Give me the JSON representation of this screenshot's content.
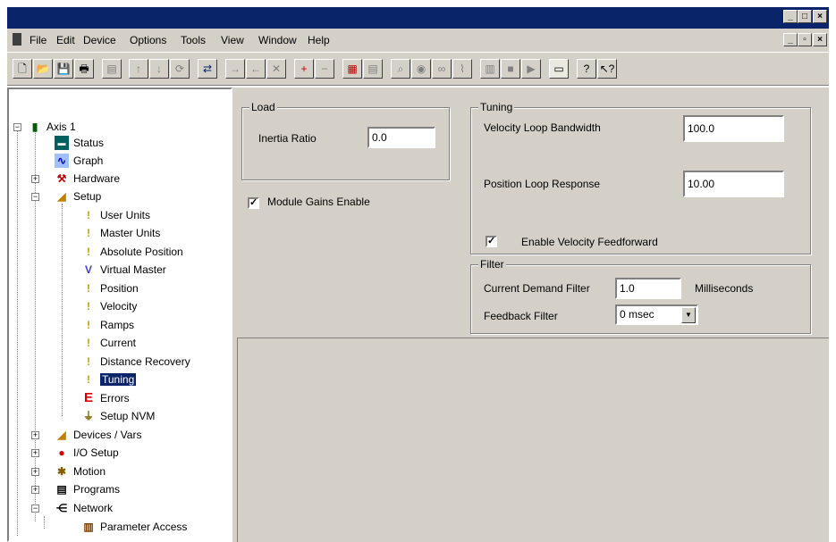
{
  "titlebar": {
    "title": ""
  },
  "menu": [
    "File",
    "Edit",
    "Device",
    "Options",
    "Tools",
    "View",
    "Window",
    "Help"
  ],
  "toolbar": {
    "icons": [
      "new-icon",
      "open-icon",
      "save-icon",
      "print-icon",
      "import-icon",
      "upload-icon",
      "download-icon",
      "sync-icon",
      "connect-icon",
      "move-right-icon",
      "move-left-icon",
      "delete-icon",
      "add-icon",
      "remove-icon",
      "properties-icon",
      "document-icon",
      "zoom-icon",
      "view-icon",
      "goggles-icon",
      "chart-icon",
      "device-icon",
      "stop-icon",
      "run-icon",
      "window-icon",
      "help-icon",
      "context-help-icon"
    ]
  },
  "tree": {
    "axis": "Axis 1",
    "status": "Status",
    "graph": "Graph",
    "hardware": "Hardware",
    "setup": "Setup",
    "user_units": "User Units",
    "master_units": "Master Units",
    "absolute_position": "Absolute Position",
    "virtual_master": "Virtual Master",
    "position": "Position",
    "velocity": "Velocity",
    "ramps": "Ramps",
    "current": "Current",
    "distance_recovery": "Distance Recovery",
    "tuning": "Tuning",
    "errors": "Errors",
    "setup_nvm": "Setup NVM",
    "devices_vars": "Devices / Vars",
    "io_setup": "I/O Setup",
    "motion": "Motion",
    "programs": "Programs",
    "network": "Network",
    "parameter_access": "Parameter Access"
  },
  "load": {
    "legend": "Load",
    "inertia_label": "Inertia Ratio",
    "inertia_value": "0.0",
    "module_gains_label": "Module Gains Enable",
    "module_gains_checked": true
  },
  "tuning": {
    "legend": "Tuning",
    "vel_bw_label": "Velocity Loop Bandwidth",
    "vel_bw_value": "100.0",
    "pos_resp_label": "Position Loop Response",
    "pos_resp_value": "10.00",
    "vel_ff_label": "Enable Velocity Feedforward",
    "vel_ff_checked": true
  },
  "filter": {
    "legend": "Filter",
    "cdf_label": "Current Demand Filter",
    "cdf_value": "1.0",
    "cdf_unit": "Milliseconds",
    "fb_label": "Feedback Filter",
    "fb_value": "0 msec"
  },
  "colors": {
    "titlebar": "#0a246a",
    "face": "#d4d0c8",
    "selection": "#0a246a"
  }
}
